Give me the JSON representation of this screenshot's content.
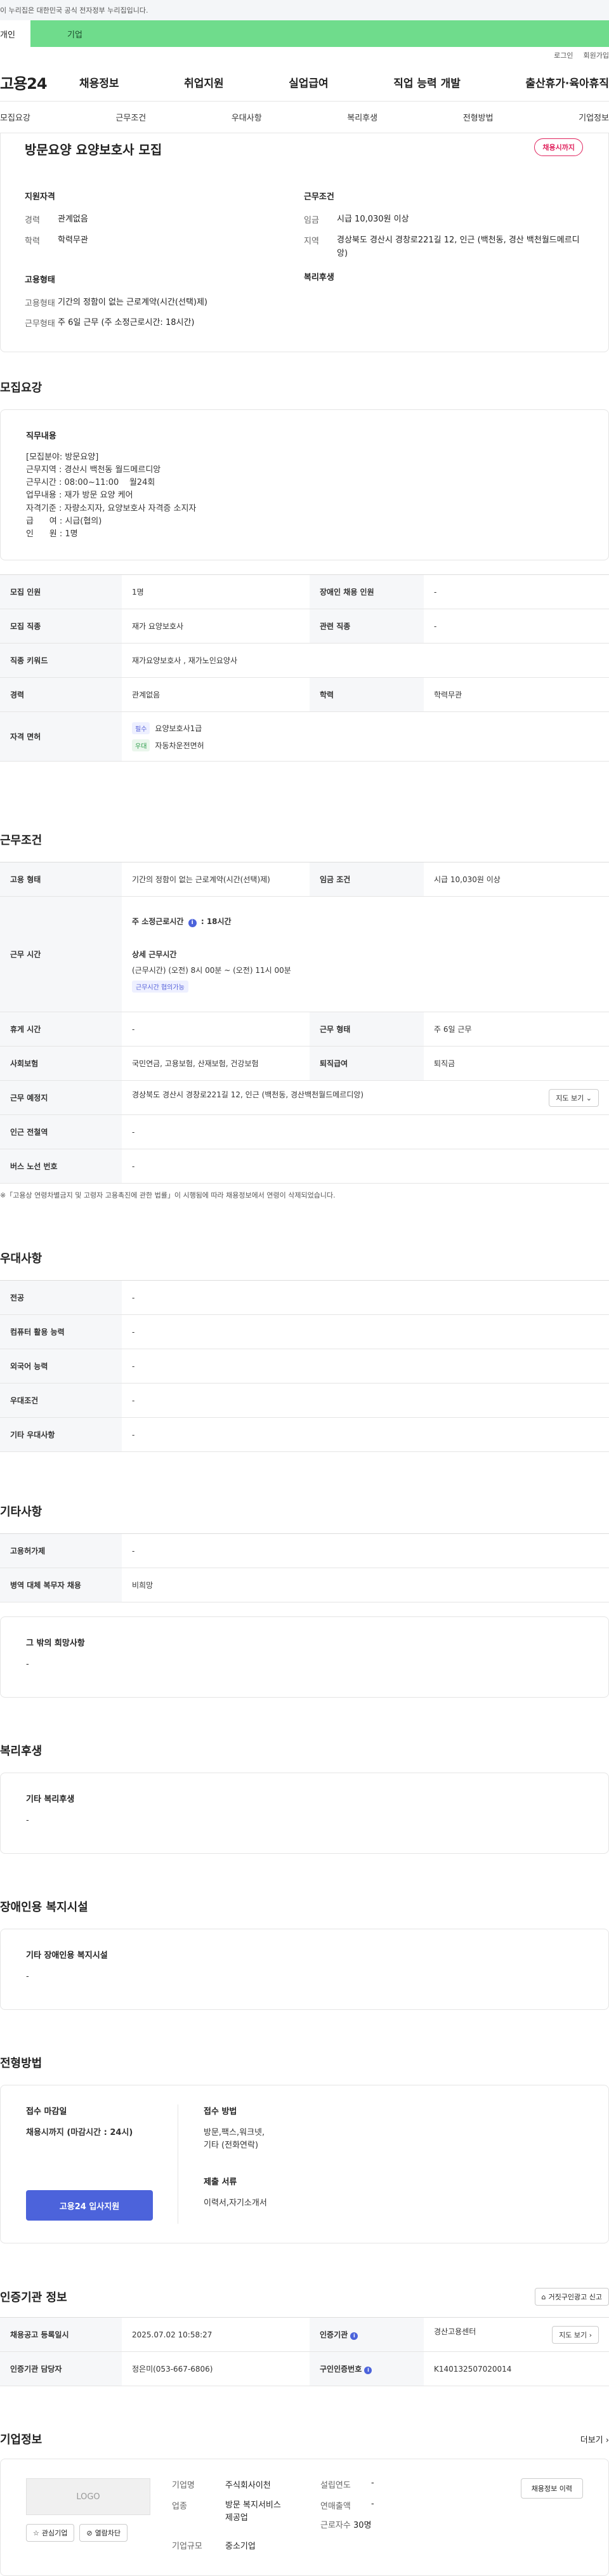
{
  "gov_bar": {
    "text": "이 누리집은 대한민국 공식 전자정부 누리집입니다."
  },
  "user_bar": {
    "personal": "개인",
    "company": "기업"
  },
  "util": {
    "login": "로그인",
    "signup": "회원가입"
  },
  "gnb": {
    "logo": "고용24",
    "menu": [
      "채용정보",
      "취업지원",
      "실업급여",
      "직업 능력 개발",
      "출산휴가·육아휴직"
    ]
  },
  "anchors": [
    "모집요강",
    "근무조건",
    "우대사항",
    "복리후생",
    "전형방법",
    "기업정보"
  ],
  "job": {
    "title": "방문요양 요양보호사 모집",
    "deadline_badge": "채용시까지",
    "qual_title": "지원자격",
    "career_k": "경력",
    "career_v": "관계없음",
    "edu_k": "학력",
    "edu_v": "학력무관",
    "emp_title": "고용형태",
    "emp_type_k": "고용형태",
    "emp_type_v": "기간의 정함이 없는 근로계약(시간(선택)제)",
    "emp_work_k": "근무형태",
    "emp_work_v": "주 6일 근무 (주 소정근로시간: 18시간)",
    "cond_title": "근무조건",
    "wage_k": "임금",
    "wage_v": "시급 10,030원 이상",
    "region_k": "지역",
    "region_v": "경상북도 경산시 경창로221길 12, 인근 (백천동, 경산 백천월드메르디앙)",
    "welfare_title": "복리후생"
  },
  "recruit": {
    "title": "모집요강",
    "duty_title": "직무내용",
    "duty_text": "[모집분야: 방문요양]\n근무지역 : 경산시 백천동 월드메르디앙\n근무시간 : 08:00~11:00    월24회\n업무내용 : 재가 방문 요양 케어\n자격기준 : 자량소지자, 요양보호사 자격증 소지자\n급      여 : 시급(협의)\n인      원 : 1명",
    "rows": {
      "count_k": "모집 인원",
      "count_v": "1명",
      "disabled_k": "장애인 채용 인원",
      "disabled_v": "-",
      "job_k": "모집 직종",
      "job_v": "재가 요양보호사",
      "related_k": "관련 직종",
      "related_v": "-",
      "keyword_k": "직종 키워드",
      "keyword_v": "재가요양보호사 , 재가노인요양사",
      "career_k": "경력",
      "career_v": "관계없음",
      "edu_k": "학력",
      "edu_v": "학력무관",
      "license_k": "자격 면허",
      "must_tag": "필수",
      "must_v": "요양보호사1급",
      "pref_tag": "우대",
      "pref_v": "자동차운전면허"
    }
  },
  "conditions": {
    "title": "근무조건",
    "emp_k": "고용 형태",
    "emp_v": "기간의 정함이 없는 근로계약(시간(선택)제)",
    "wage_k": "임금 조건",
    "wage_v": "시급 10,030원 이상",
    "time_k": "근무 시간",
    "weekly_label": "주 소정근로시간",
    "weekly_v": ": 18시간",
    "detail_title": "상세 근무시간",
    "detail_v": "(근무시간) (오전) 8시 00분 ~ (오전) 11시 00분",
    "nego_tag": "근무시간 협의가능",
    "rest_k": "휴게 시간",
    "rest_v": "-",
    "work_type_k": "근무 형태",
    "work_type_v": "주 6일 근무",
    "insurance_k": "사회보험",
    "insurance_v": "국민연금, 고용보험, 산재보험, 건강보험",
    "severance_k": "퇴직급여",
    "severance_v": "퇴직금",
    "place_k": "근무 예정지",
    "place_v": "경상북도 경산시 경창로221길 12, 인근 (백천동, 경산백천월드메르디앙)",
    "map_btn": "지도 보기",
    "subway_k": "인근 전철역",
    "subway_v": "-",
    "bus_k": "버스 노선 번호",
    "bus_v": "-",
    "note": "※「고용상 연령차별금지 및 고령자 고용촉진에 관한 법률」이 시행됨에 따라 채용정보에서 연령이 삭제되었습니다."
  },
  "prefer": {
    "title": "우대사항",
    "major_k": "전공",
    "major_v": "-",
    "computer_k": "컴퓨터 활용 능력",
    "computer_v": "-",
    "lang_k": "외국어 능력",
    "lang_v": "-",
    "cond_k": "우대조건",
    "cond_v": "-",
    "etc_k": "기타 우대사항",
    "etc_v": "-"
  },
  "others": {
    "title": "기타사항",
    "hire_k": "고용허가제",
    "hire_v": "-",
    "army_k": "병역 대체 복무자 채용",
    "army_v": "비희망",
    "wish_title": "그 밖의 희망사항",
    "wish_v": "-"
  },
  "welfare": {
    "title": "복리후생",
    "box_title": "기타 복리후생",
    "box_v": "-"
  },
  "disabled": {
    "title": "장애인용 복지시설",
    "box_title": "기타 장애인용 복지시설",
    "box_v": "-"
  },
  "process": {
    "title": "전형방법",
    "deadline_title": "접수 마감일",
    "deadline_v": "채용시까지 (마감시간 : 24시)",
    "apply_btn": "고용24 입사지원",
    "method_title": "접수 방법",
    "method_v": "방문,팩스,워크넷,\n기타 (전화연락)",
    "docs_title": "제출 서류",
    "docs_v": "이력서,자기소개서"
  },
  "cert": {
    "title": "인증기관 정보",
    "report_btn": "거짓구인광고 신고",
    "reg_k": "채용공고 등록일시",
    "reg_v": "2025.07.02 10:58:27",
    "org_k": "인증기관",
    "org_v": "경산고용센터",
    "map_btn": "지도 보기",
    "manager_k": "인증기관 담당자",
    "manager_v": "정은미(053-667-6806)",
    "id_k": "구인인증번호",
    "id_v": "K140132507020014"
  },
  "company": {
    "title": "기업정보",
    "more": "더보기",
    "logo": "LOGO",
    "interest_btn": "관심기업",
    "block_btn": "열람차단",
    "name_k": "기업명",
    "name_v": "주식회사이천",
    "found_k": "설립연도",
    "found_v": "-",
    "industry_k": "업종",
    "industry_v": "방문 복지서비스\n제공업",
    "sales_k": "연매출액",
    "sales_v": "-",
    "staff_k": "근로자수",
    "staff_v": "30명",
    "size_k": "기업규모",
    "size_v": "중소기업",
    "history_btn": "채용정보 이력"
  }
}
